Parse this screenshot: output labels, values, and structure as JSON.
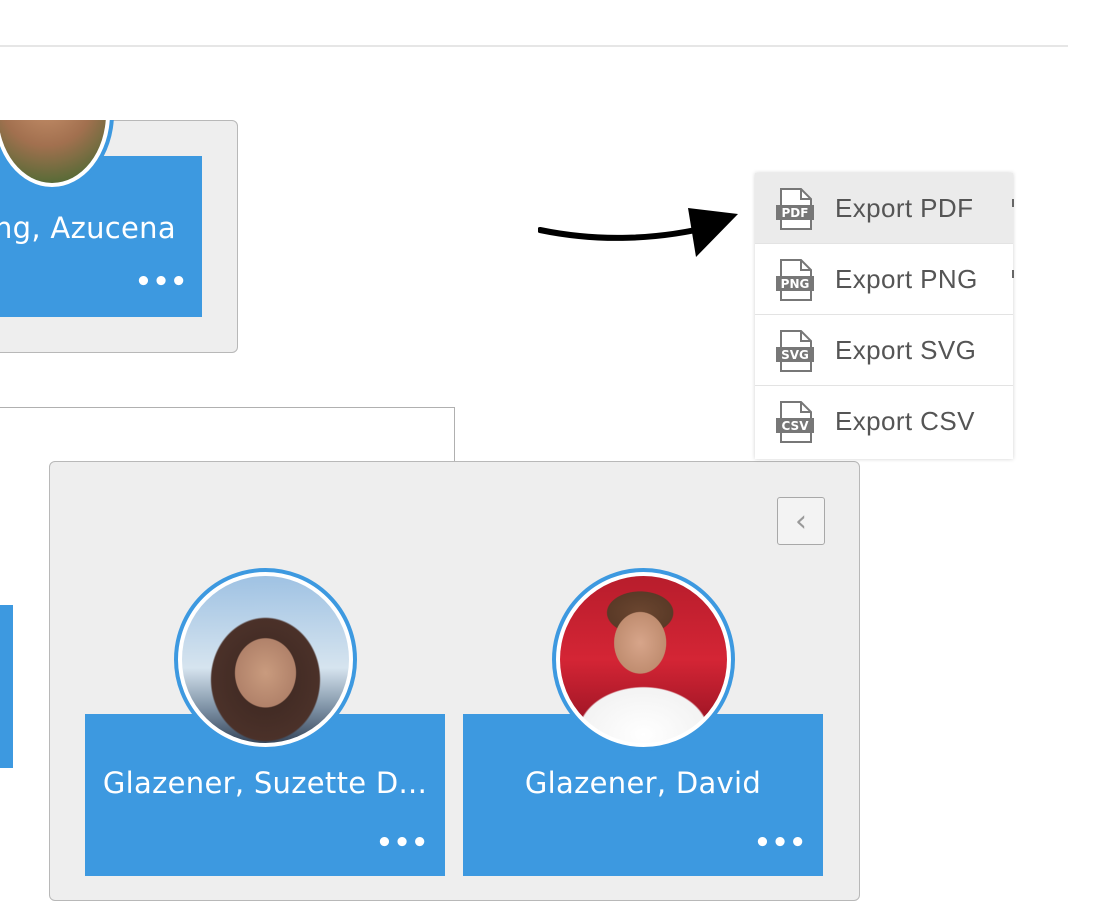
{
  "nodes": {
    "top_left": {
      "name": "ng, Azucena",
      "more": "•••"
    },
    "suzette": {
      "name": "Glazener, Suzette D...",
      "more": "•••"
    },
    "david": {
      "name": "Glazener, David",
      "more": "•••"
    }
  },
  "group": {
    "collapse_glyph": "‹"
  },
  "export_menu": {
    "items": [
      {
        "label": "Export PDF",
        "icon": "pdf-file-icon",
        "badge": "PDF"
      },
      {
        "label": "Export PNG",
        "icon": "png-file-icon",
        "badge": "PNG"
      },
      {
        "label": "Export SVG",
        "icon": "svg-file-icon",
        "badge": "SVG"
      },
      {
        "label": "Export CSV",
        "icon": "csv-file-icon",
        "badge": "CSV"
      }
    ]
  },
  "colors": {
    "accent": "#3d99e0",
    "panel": "#eeeeee",
    "menu_text": "#555555"
  }
}
